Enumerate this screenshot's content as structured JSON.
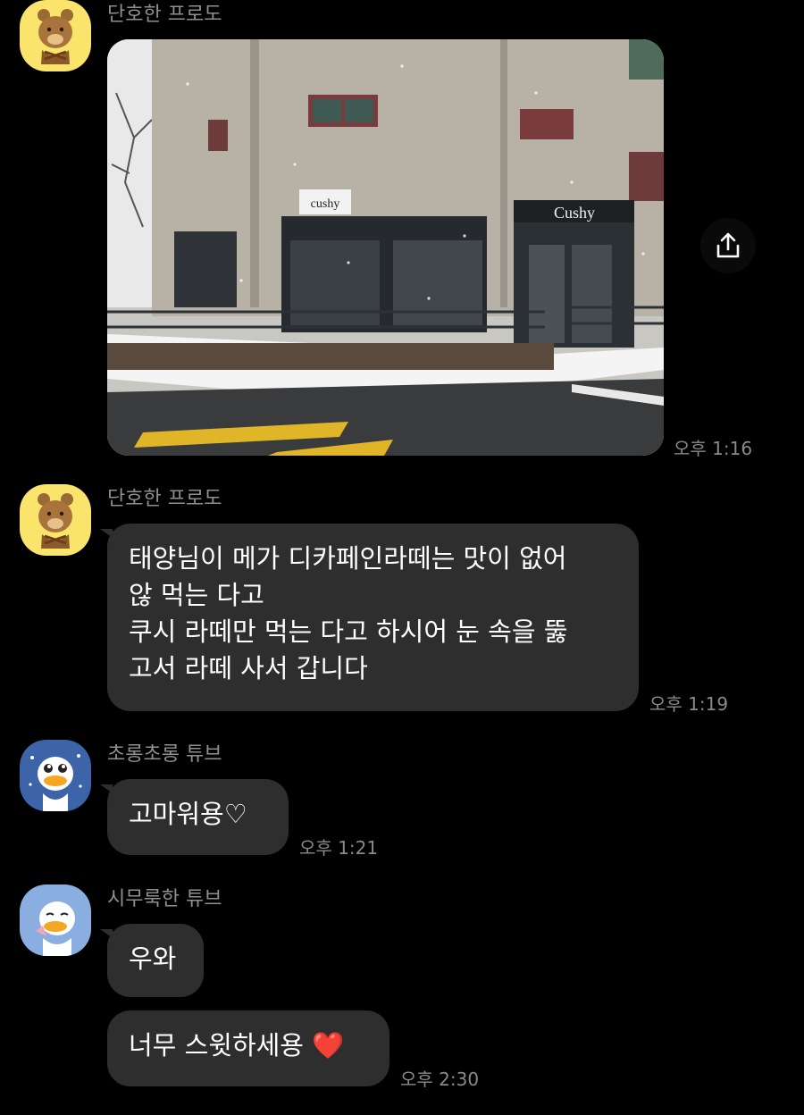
{
  "messages": [
    {
      "sender": "단호한 프로도",
      "avatar_icon": "frodo-dog-icon",
      "photo": {
        "description_icon": "snowy-cafe-photo",
        "signs": [
          "cushy",
          "Cushy"
        ]
      },
      "time": "오후 1:16"
    },
    {
      "sender": "단호한 프로도",
      "avatar_icon": "frodo-dog-icon",
      "text": "태양님이 메가 디카페인라떼는 맛이 없어\n않 먹는 다고\n쿠시 라떼만 먹는 다고 하시어 눈 속을 뚫\n고서 라떼 사서 갑니다",
      "time": "오후 1:19"
    },
    {
      "sender": "초롱초롱 튜브",
      "avatar_icon": "tube-duck-sparkle-icon",
      "text": "고마워용♡",
      "time": "오후 1:21"
    },
    {
      "sender": "시무룩한 튜브",
      "avatar_icon": "tube-duck-sad-icon",
      "texts": [
        "우와",
        "너무 스윗하세용"
      ],
      "emoji": "❤️",
      "time": "오후 2:30"
    }
  ],
  "share_icon": "share-icon",
  "colors": {
    "background": "#000000",
    "bubble": "#2e2e2e",
    "sender": "#8f8f8f",
    "time": "#8a8a8a",
    "frodo_avatar_bg": "#fbe46c",
    "tube_avatar_bg": "#3d63a8"
  }
}
